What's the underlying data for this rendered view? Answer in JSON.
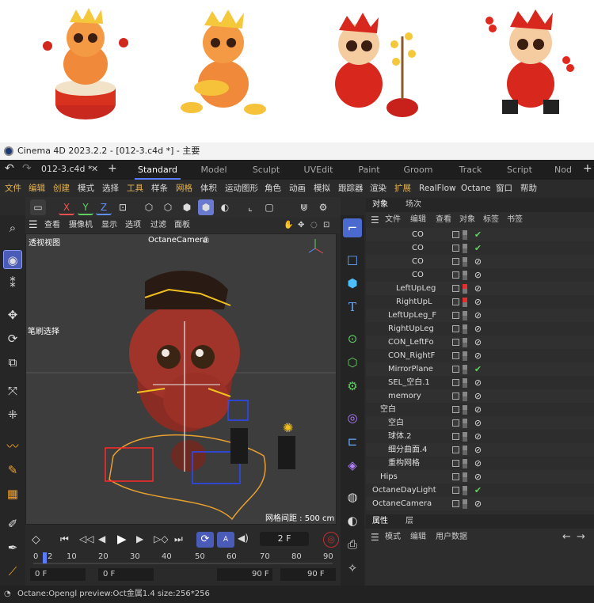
{
  "window": {
    "title": "Cinema 4D 2023.2.2 - [012-3.c4d *] - 主要"
  },
  "file_tab": "012-3.c4d *",
  "layout_tabs": [
    "Standard",
    "Model",
    "Sculpt",
    "UVEdit",
    "Paint",
    "Groom",
    "Track",
    "Script",
    "Nod"
  ],
  "active_layout": "Standard",
  "menu": [
    "文件",
    "编辑",
    "创建",
    "模式",
    "选择",
    "工具",
    "样条",
    "网格",
    "体积",
    "运动图形",
    "角色",
    "动画",
    "模拟",
    "跟踪器",
    "渲染",
    "扩展",
    "RealFlow",
    "Octane",
    "窗口",
    "帮助"
  ],
  "axis_buttons": [
    "X",
    "Y",
    "Z"
  ],
  "viewport_menu": [
    "查看",
    "摄像机",
    "显示",
    "选项",
    "过滤",
    "面板"
  ],
  "viewport": {
    "label": "透视视图",
    "camera": "OctaneCamera",
    "brush_hint": "笔刷选择",
    "grid_spacing": "网格间距 : 500 cm"
  },
  "timeline": {
    "current_frame": "2 F",
    "ticks": [
      "0",
      "2",
      "10",
      "20",
      "30",
      "40",
      "50",
      "60",
      "70",
      "80",
      "90"
    ],
    "field_start": "0 F",
    "field_current": "0 F",
    "field_end": "90 F",
    "field_max": "90 F"
  },
  "object_panel": {
    "tabs": [
      "对象",
      "场次"
    ],
    "menu": [
      "文件",
      "编辑",
      "查看",
      "对象",
      "标签",
      "书签"
    ],
    "rows": [
      {
        "name": "CO",
        "indent": 5,
        "checked": true,
        "red": false
      },
      {
        "name": "CO",
        "indent": 5,
        "checked": true,
        "red": false
      },
      {
        "name": "CO",
        "indent": 5,
        "checked": false,
        "red": false
      },
      {
        "name": "CO",
        "indent": 5,
        "checked": false,
        "red": false
      },
      {
        "name": "LeftUpLeg",
        "indent": 3,
        "checked": false,
        "red": true
      },
      {
        "name": "RightUpL",
        "indent": 3,
        "checked": false,
        "red": true
      },
      {
        "name": "LeftUpLeg_F",
        "indent": 2,
        "checked": false,
        "red": false
      },
      {
        "name": "RightUpLeg",
        "indent": 2,
        "checked": false,
        "red": false
      },
      {
        "name": "CON_LeftFo",
        "indent": 2,
        "checked": false,
        "red": false
      },
      {
        "name": "CON_RightF",
        "indent": 2,
        "checked": false,
        "red": false
      },
      {
        "name": "MirrorPlane",
        "indent": 2,
        "checked": true,
        "red": false
      },
      {
        "name": "SEL_空白.1",
        "indent": 2,
        "checked": false,
        "red": false
      },
      {
        "name": "memory",
        "indent": 2,
        "checked": false,
        "red": false
      },
      {
        "name": "空白",
        "indent": 1,
        "checked": false,
        "red": false
      },
      {
        "name": "空白",
        "indent": 2,
        "checked": false,
        "red": false
      },
      {
        "name": "球体.2",
        "indent": 2,
        "checked": false,
        "red": false
      },
      {
        "name": "细分曲面.4",
        "indent": 2,
        "checked": false,
        "red": false
      },
      {
        "name": "重构网格",
        "indent": 2,
        "checked": false,
        "red": false
      },
      {
        "name": "Hips",
        "indent": 1,
        "checked": false,
        "red": false
      },
      {
        "name": "OctaneDayLight",
        "indent": 0,
        "checked": true,
        "red": false
      },
      {
        "name": "OctaneCamera",
        "indent": 0,
        "checked": false,
        "red": false
      }
    ]
  },
  "attr_panel": {
    "tabs": [
      "属性",
      "层"
    ],
    "menu": [
      "模式",
      "编辑",
      "用户数据"
    ]
  },
  "status": "Octane:Opengl preview:Oct金属1.4  size:256*256",
  "colors": {
    "accent": "#5a7bff",
    "highlight": "#e9b44c",
    "selection": "#f0c020"
  }
}
